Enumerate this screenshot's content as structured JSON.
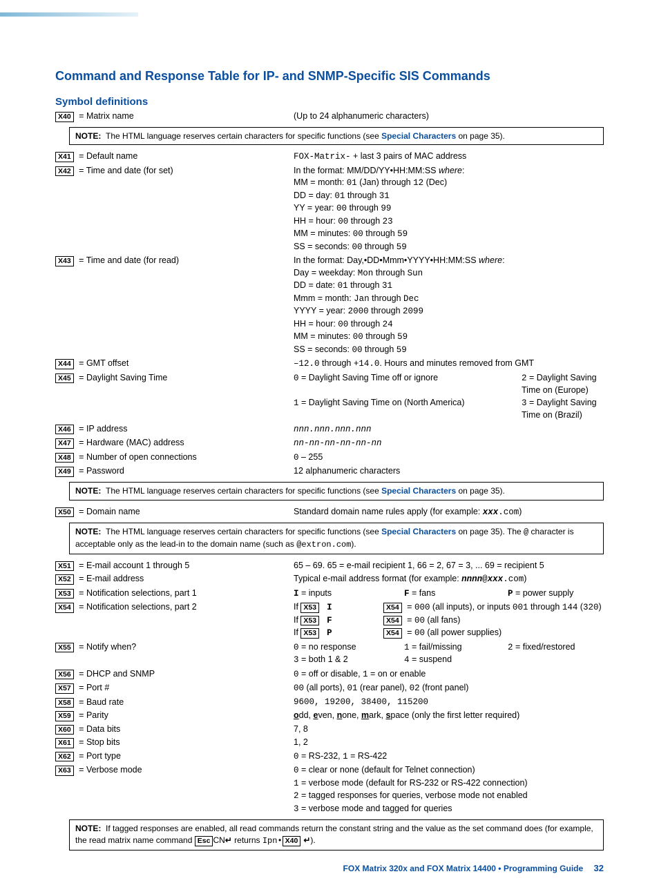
{
  "title": "Command and Response Table for IP- and SNMP-Specific SIS Commands",
  "subhead": "Symbol definitions",
  "notes": {
    "n1_pre": "The HTML language reserves certain characters for specific functions (see ",
    "n1_link": "Special Characters",
    "n1_post": " on page 35).",
    "n3_pre": "The HTML language reserves certain characters for specific functions (see ",
    "n3_link": "Special Characters",
    "n3_post_a": " on page 35). The ",
    "n3_at": "@",
    "n3_post_b": " character is acceptable only as the lead-in to the domain name (such as ",
    "n3_ex": "@extron.com",
    "n3_post_c": ").",
    "n4_a": "If tagged responses are enabled, all read commands return the constant string and the value as the set command does (for example, the read matrix name command ",
    "n4_esc": "Esc",
    "n4_b": "CN",
    "n4_c": " returns ",
    "n4_d": "Ipn•",
    "n4_x": "X40",
    "n4_e": ")."
  },
  "x40": {
    "tag": "X40",
    "label": "Matrix name",
    "desc": "(Up to 24 alphanumeric characters)"
  },
  "x41": {
    "tag": "X41",
    "label": "Default name",
    "desc_a": "FOX-Matrix-",
    "desc_b": " + last 3 pairs of MAC address"
  },
  "x42": {
    "tag": "X42",
    "label": "Time and date (for set)",
    "l1a": "In the format: MM/DD/YY•HH:MM:SS ",
    "l1b": "where",
    "l2": "MM = month: ",
    "l2b": "01",
    "l2c": " (Jan) through ",
    "l2d": "12",
    "l2e": " (Dec)",
    "l3": "DD = day: ",
    "l3b": "01",
    "l3c": " through ",
    "l3d": "31",
    "l4": "YY = year: ",
    "l4b": "00",
    "l4c": " through ",
    "l4d": "99",
    "l5": "HH = hour: ",
    "l5b": "00",
    "l5c": " through ",
    "l5d": "23",
    "l6": "MM = minutes: ",
    "l6b": "00",
    "l6c": " through ",
    "l6d": "59",
    "l7": "SS = seconds: ",
    "l7b": "00",
    "l7c": " through ",
    "l7d": "59"
  },
  "x43": {
    "tag": "X43",
    "label": "Time and date (for read)",
    "l1a": "In the format: Day,•DD•Mmm•YYYY•HH:MM:SS ",
    "l1b": "where",
    "l2": "Day = weekday: ",
    "l2b": "Mon",
    "l2c": " through ",
    "l2d": "Sun",
    "l3": "DD = date: ",
    "l3b": "01",
    "l3c": " through ",
    "l3d": "31",
    "l4": "Mmm = month: ",
    "l4b": "Jan",
    "l4c": " through ",
    "l4d": "Dec",
    "l5": "YYYY = year: ",
    "l5b": "2000",
    "l5c": " through ",
    "l5d": "2099",
    "l6": "HH = hour: ",
    "l6b": "00",
    "l6c": " through ",
    "l6d": "24",
    "l7": "MM = minutes: ",
    "l7b": "00",
    "l7c": " through ",
    "l7d": "59",
    "l8": "SS = seconds: ",
    "l8b": "00",
    "l8c": " through ",
    "l8d": "59"
  },
  "x44": {
    "tag": "X44",
    "label": "GMT offset",
    "d1": "–12.0",
    "d2": " through ",
    "d3": "+14.0",
    "d4": ". Hours and minutes removed from GMT"
  },
  "x45": {
    "tag": "X45",
    "label": "Daylight Saving Time",
    "a": "0",
    "at": " = Daylight Saving Time off or ignore",
    "b": "1",
    "bt": " = Daylight Saving Time on (North America)",
    "c": "2",
    "ct": " = Daylight Saving Time on (Europe)",
    "d": "3",
    "dt": " = Daylight Saving Time on (Brazil)"
  },
  "x46": {
    "tag": "X46",
    "label": "IP address",
    "desc": "nnn.nnn.nnn.nnn"
  },
  "x47": {
    "tag": "X47",
    "label": "Hardware (MAC) address",
    "desc": "nn-nn-nn-nn-nn-nn"
  },
  "x48": {
    "tag": "X48",
    "label": "Number of open connections",
    "d1": "0",
    "d2": " – 255"
  },
  "x49": {
    "tag": "X49",
    "label": "Password",
    "desc": "12 alphanumeric characters"
  },
  "x50": {
    "tag": "X50",
    "label": "Domain name",
    "d1": "Standard domain name rules apply (for example: ",
    "d2": "xxx",
    "d3": ".com",
    "d4": ")"
  },
  "x51": {
    "tag": "X51",
    "label": "E-mail account 1 through 5",
    "d": "65 – 69. 65 = e-mail recipient 1, 66 = 2, 67 = 3, ... 69 = recipient 5"
  },
  "x52": {
    "tag": "X52",
    "label": "E-mail address",
    "d1": "Typical e-mail address format (for example: ",
    "d2": "nnnn",
    "d3": "@",
    "d4": "xxx",
    "d5": ".com",
    "d6": ")"
  },
  "x53": {
    "tag": "X53",
    "label": "Notification selections, part 1",
    "a": "I",
    "at": " = inputs",
    "b": "F",
    "bt": " = fans",
    "c": "P",
    "ct": " = power supply"
  },
  "x54": {
    "tag": "X54",
    "label": "Notification selections, part 2",
    "if": "If ",
    "x53": "X53",
    "x54": "X54",
    "ia": "I",
    "ta": " = ",
    "va": "000",
    "wa": " (all inputs), or inputs ",
    "vb": "001",
    "wb": " through ",
    "vc": "144",
    "wc": " (",
    "vd": "320",
    "wd": ")",
    "ib": "F",
    "vb2": "00",
    "wb2": " (all fans)",
    "ic": "P",
    "vc2": "00",
    "wc2": " (all power supplies)"
  },
  "x55": {
    "tag": "X55",
    "label": "Notify when?",
    "a": "0",
    "at": " = no response",
    "b": "1",
    "bt": " = fail/missing",
    "c": "2",
    "ct": " = fixed/restored",
    "d": "3",
    "dt": " = both 1 & 2",
    "e": "4",
    "et": " = suspend"
  },
  "x56": {
    "tag": "X56",
    "label": "DHCP and SNMP",
    "a": "0",
    "at": " = off or disable, ",
    "b": "1",
    "bt": " = on or enable"
  },
  "x57": {
    "tag": "X57",
    "label": "Port #",
    "a": "00",
    "at": " (all ports), ",
    "b": "01",
    "bt": " (rear panel), ",
    "c": "02",
    "ct": " (front panel)"
  },
  "x58": {
    "tag": "X58",
    "label": "Baud rate",
    "d": "9600, 19200, 38400, 115200"
  },
  "x59": {
    "tag": "X59",
    "label": "Parity",
    "a": "o",
    "at": "dd, ",
    "b": "e",
    "bt": "ven, ",
    "c": "n",
    "ct": "one, ",
    "d": "m",
    "dt": "ark, ",
    "e": "s",
    "et": "pace (only the first letter required)"
  },
  "x60": {
    "tag": "X60",
    "label": "Data bits",
    "d": "7, 8"
  },
  "x61": {
    "tag": "X61",
    "label": "Stop bits",
    "d": "1, 2"
  },
  "x62": {
    "tag": "X62",
    "label": "Port type",
    "a": "0",
    "at": " = RS-232, ",
    "b": "1",
    "bt": " = RS-422"
  },
  "x63": {
    "tag": "X63",
    "label": "Verbose mode",
    "a": "0",
    "at": " = clear or none (default for Telnet connection)",
    "b": "1",
    "bt": " = verbose mode (default for RS-232 or RS-422 connection)",
    "c": "2",
    "ct": " = tagged responses for queries, verbose mode not enabled",
    "d": "3",
    "dt": " = verbose mode and tagged for queries"
  },
  "footer": {
    "product": "FOX Matrix 320x and FOX Matrix 14400 • Programming Guide",
    "page": "32"
  }
}
